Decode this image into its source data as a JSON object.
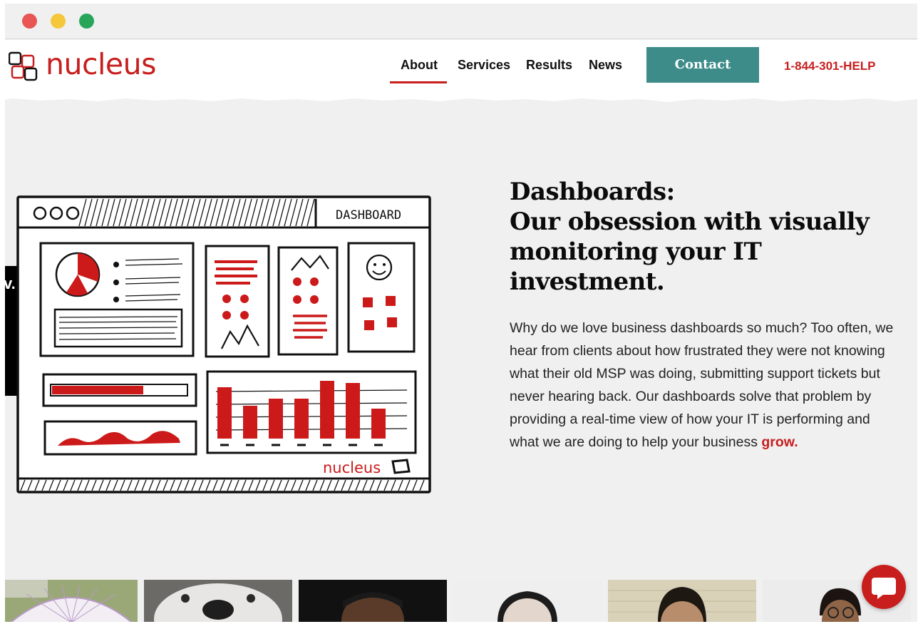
{
  "window": {
    "controls": [
      "close",
      "minimize",
      "maximize"
    ]
  },
  "nav": {
    "logo_text": "nucleus",
    "links": [
      {
        "label": "About",
        "active": true
      },
      {
        "label": "Services",
        "active": false
      },
      {
        "label": "Results",
        "active": false
      },
      {
        "label": "News",
        "active": false
      }
    ],
    "contact_label": "Contact",
    "phone": "1-844-301-HELP"
  },
  "side_tab": {
    "text": "v."
  },
  "illustration": {
    "dashboard_label": "DASHBOARD",
    "brand_label": "nucleus"
  },
  "hero": {
    "title": "Dashboards:",
    "subtitle": "Our obsession with visually monitoring your IT investment.",
    "body": "Why do we love business dashboards so much? Too often, we hear from clients about how frustrated they were not knowing what their old MSP was doing, submitting support tickets but never hearing back. Our dashboards solve that problem by providing a real-time view of how your IT is performing and what we are doing to help your business ",
    "body_emphasis": "grow."
  },
  "colors": {
    "brand_red": "#c81e1e",
    "contact_teal": "#3d8c8a",
    "background": "#f0f0f0"
  },
  "icons": {
    "chat": "chat-bubble-icon",
    "logo": "nucleus-logo-icon"
  }
}
